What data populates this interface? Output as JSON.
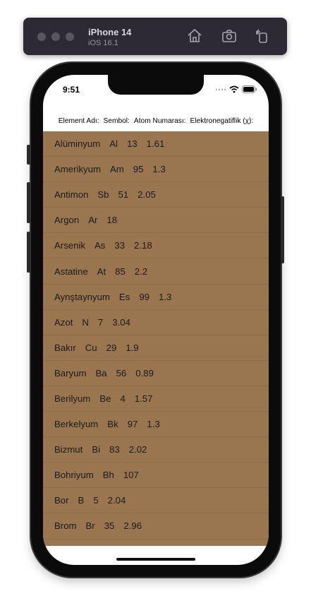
{
  "simulator": {
    "device_name": "iPhone 14",
    "os_version": "iOS 16.1"
  },
  "status_bar": {
    "time": "9:51"
  },
  "header": {
    "element_name": "Element Adı:",
    "symbol": "Sembol:",
    "atomic_number": "Atom Numarası:",
    "electronegativity": "Elektronegatiflik (χ):"
  },
  "elements": [
    {
      "name": "Alüminyum",
      "symbol": "Al",
      "number": "13",
      "en": "1.61"
    },
    {
      "name": "Amerikyum",
      "symbol": "Am",
      "number": "95",
      "en": "1.3"
    },
    {
      "name": "Antimon",
      "symbol": "Sb",
      "number": "51",
      "en": "2.05"
    },
    {
      "name": "Argon",
      "symbol": "Ar",
      "number": "18",
      "en": ""
    },
    {
      "name": "Arsenik",
      "symbol": "As",
      "number": "33",
      "en": "2.18"
    },
    {
      "name": "Astatine",
      "symbol": "At",
      "number": "85",
      "en": "2.2"
    },
    {
      "name": "Aynştaynyum",
      "symbol": "Es",
      "number": "99",
      "en": "1.3"
    },
    {
      "name": "Azot",
      "symbol": "N",
      "number": "7",
      "en": "3.04"
    },
    {
      "name": "Bakır",
      "symbol": "Cu",
      "number": "29",
      "en": "1.9"
    },
    {
      "name": "Baryum",
      "symbol": "Ba",
      "number": "56",
      "en": "0.89"
    },
    {
      "name": "Berilyum",
      "symbol": "Be",
      "number": "4",
      "en": "1.57"
    },
    {
      "name": "Berkelyum",
      "symbol": "Bk",
      "number": "97",
      "en": "1.3"
    },
    {
      "name": "Bizmut",
      "symbol": "Bi",
      "number": "83",
      "en": "2.02"
    },
    {
      "name": "Bohriyum",
      "symbol": "Bh",
      "number": "107",
      "en": ""
    },
    {
      "name": "Bor",
      "symbol": "B",
      "number": "5",
      "en": "2.04"
    },
    {
      "name": "Brom",
      "symbol": "Br",
      "number": "35",
      "en": "2.96"
    }
  ],
  "colors": {
    "list_background": "#9a7650",
    "toolbar_background": "#2e2a35"
  }
}
